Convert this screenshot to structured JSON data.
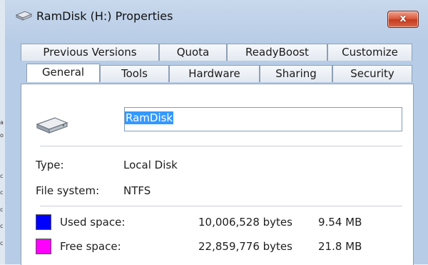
{
  "window": {
    "title": "RamDisk (H:) Properties",
    "close_label": "x"
  },
  "tabs_back": [
    {
      "label": "Previous Versions"
    },
    {
      "label": "Quota"
    },
    {
      "label": "ReadyBoost"
    },
    {
      "label": "Customize"
    }
  ],
  "tabs_front": [
    {
      "label": "General",
      "active": true
    },
    {
      "label": "Tools"
    },
    {
      "label": "Hardware"
    },
    {
      "label": "Sharing"
    },
    {
      "label": "Security"
    }
  ],
  "general": {
    "volume_name": "RamDisk",
    "type_label": "Type:",
    "type_value": "Local Disk",
    "fs_label": "File system:",
    "fs_value": "NTFS",
    "used": {
      "label": "Used space:",
      "bytes": "10,006,528 bytes",
      "size": "9.54 MB",
      "color": "#0000ff"
    },
    "free": {
      "label": "Free space:",
      "bytes": "22,859,776 bytes",
      "size": "21.8 MB",
      "color": "#ff00ff"
    }
  },
  "background": {
    "edge_marks": [
      "a",
      "o",
      "c",
      "c",
      "c",
      "c",
      "c"
    ]
  }
}
